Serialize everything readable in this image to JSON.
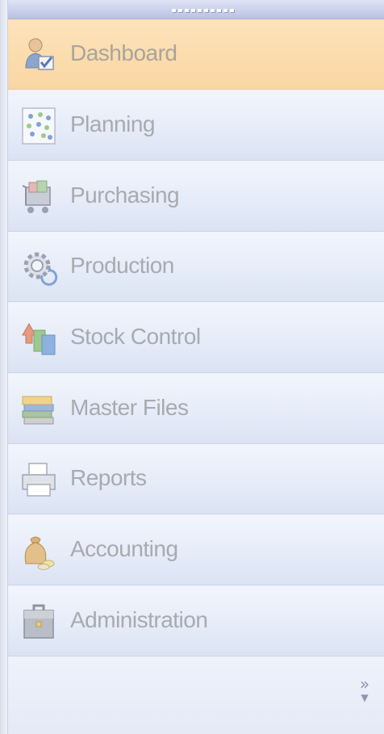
{
  "navigation_pane": {
    "items": [
      {
        "label": "Dashboard",
        "icon": "dashboard-icon",
        "active": true
      },
      {
        "label": "Planning",
        "icon": "planning-icon"
      },
      {
        "label": "Purchasing",
        "icon": "purchasing-icon"
      },
      {
        "label": "Production",
        "icon": "production-icon"
      },
      {
        "label": "Stock Control",
        "icon": "stock-control-icon"
      },
      {
        "label": "Master Files",
        "icon": "master-files-icon"
      },
      {
        "label": "Reports",
        "icon": "reports-icon"
      },
      {
        "label": "Accounting",
        "icon": "accounting-icon"
      },
      {
        "label": "Administration",
        "icon": "administration-icon"
      }
    ],
    "footer": {
      "overflow_glyph": "»",
      "dropdown_glyph": "▼"
    },
    "colors": {
      "active_bg": "#fbdcae",
      "item_bg": "#e6ecf8",
      "label_text": "#a8aab0"
    }
  }
}
